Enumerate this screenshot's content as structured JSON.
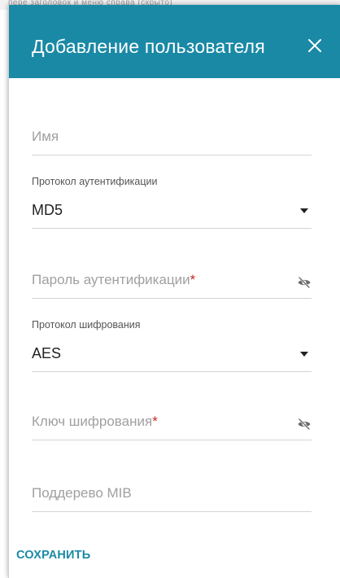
{
  "background": {
    "partial_text": "пере  заголовок и меню справа (скрыто)"
  },
  "dialog": {
    "title": "Добавление пользователя",
    "close_icon": "close-icon",
    "header_color": "#1a89a6"
  },
  "form": {
    "name": {
      "placeholder": "Имя",
      "value": ""
    },
    "auth_protocol": {
      "label": "Протокол аутентификации",
      "value": "MD5"
    },
    "auth_password": {
      "placeholder": "Пароль аутентификации",
      "required_mark": "*",
      "value": "",
      "icon": "eye-off-icon"
    },
    "privacy_protocol": {
      "label": "Протокол шифрования",
      "value": "AES"
    },
    "privacy_key": {
      "placeholder": "Ключ шифрования",
      "required_mark": "*",
      "value": "",
      "icon": "eye-off-icon"
    },
    "mib_subtree": {
      "placeholder": "Поддерево MIB",
      "value": ""
    }
  },
  "actions": {
    "save_label": "СОХРАНИТЬ"
  }
}
